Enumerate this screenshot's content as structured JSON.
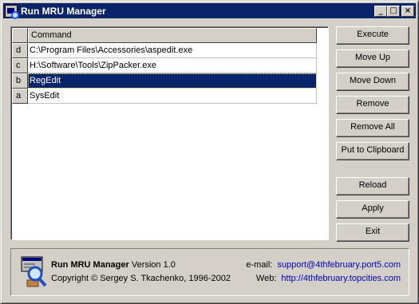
{
  "window": {
    "title": "Run MRU Manager"
  },
  "titlebar_buttons": {
    "minimize": "_",
    "maximize": "□",
    "close": "×"
  },
  "list": {
    "key_header": "",
    "command_header": "Command",
    "rows": [
      {
        "key": "d",
        "command": "C:\\Program Files\\Accessories\\aspedit.exe"
      },
      {
        "key": "c",
        "command": "H:\\Software\\Tools\\ZipPacker.exe"
      },
      {
        "key": "b",
        "command": "RegEdit"
      },
      {
        "key": "a",
        "command": "SysEdit"
      }
    ],
    "selected_key": "b"
  },
  "buttons": {
    "execute": "Execute",
    "move_up": "Move Up",
    "move_down": "Move Down",
    "remove": "Remove",
    "remove_all": "Remove All",
    "put_to_clipboard": "Put to Clipboard",
    "reload": "Reload",
    "apply": "Apply",
    "exit": "Exit"
  },
  "about": {
    "app_name": "Run MRU Manager",
    "version": "Version 1.0",
    "copyright": "Copyright © Sergey S. Tkachenko, 1996-2002",
    "email_label": "e-mail:",
    "email": "support@4thfebruary.port5.com",
    "web_label": "Web:",
    "web": "http://4thfebruary.topcities.com"
  },
  "colors": {
    "selection": "#0a246a",
    "link": "#0000c0",
    "titlebar": "#0a246a",
    "face": "#d4d0c8"
  }
}
